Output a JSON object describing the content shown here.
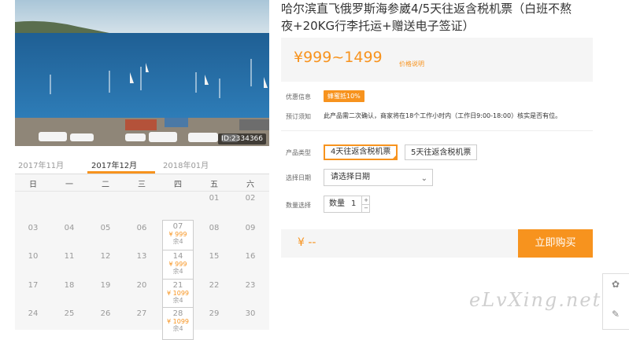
{
  "photo": {
    "id_label": "ID:2334366"
  },
  "calendar": {
    "months": [
      "2017年11月",
      "2017年12月",
      "2018年01月"
    ],
    "active_month": 1,
    "weekdays": [
      "日",
      "一",
      "二",
      "三",
      "四",
      "五",
      "六"
    ],
    "rows": [
      [
        "",
        "",
        "",
        "",
        "",
        "01",
        "02"
      ],
      [
        "03",
        "04",
        "05",
        "06",
        "07",
        "08",
        "09"
      ],
      [
        "10",
        "11",
        "12",
        "13",
        "14",
        "15",
        "16"
      ],
      [
        "17",
        "18",
        "19",
        "20",
        "21",
        "22",
        "23"
      ],
      [
        "24",
        "25",
        "26",
        "27",
        "28",
        "29",
        "30"
      ]
    ],
    "available": [
      {
        "day": "07",
        "price": "¥ 999",
        "remain": "余4"
      },
      {
        "day": "14",
        "price": "¥ 999",
        "remain": "余4"
      },
      {
        "day": "21",
        "price": "¥ 1099",
        "remain": "余4"
      },
      {
        "day": "28",
        "price": "¥ 1099",
        "remain": "余4"
      }
    ]
  },
  "product": {
    "title_line1": "哈尔滨直飞俄罗斯海参崴4/5天往返含税机票（白班不熬",
    "title_line2": "夜+20KG行李托运+赠送电子签证）",
    "price_range": "¥999~1499",
    "price_note": "价格说明",
    "promo_label": "优惠信息",
    "promo_badge": "蜂蜜抵10%",
    "notice_label": "预订须知",
    "notice_text": "此产品需二次确认，商家将在18个工作小时内（工作日9:00-18:00）核实是否有位。",
    "type_label": "产品类型",
    "types": [
      "4天往返含税机票",
      "5天往返含税机票"
    ],
    "selected_type": 0,
    "date_label": "选择日期",
    "date_placeholder": "请选择日期",
    "qty_label": "数量选择",
    "qty_inner_label": "数量",
    "qty_value": "1",
    "total": "¥ --",
    "buy_label": "立即购买"
  },
  "colors": {
    "accent": "#f7931e"
  },
  "watermark": "eLvXing.net",
  "side_tools": {
    "icons": [
      "leaf-icon",
      "edit-icon"
    ]
  }
}
